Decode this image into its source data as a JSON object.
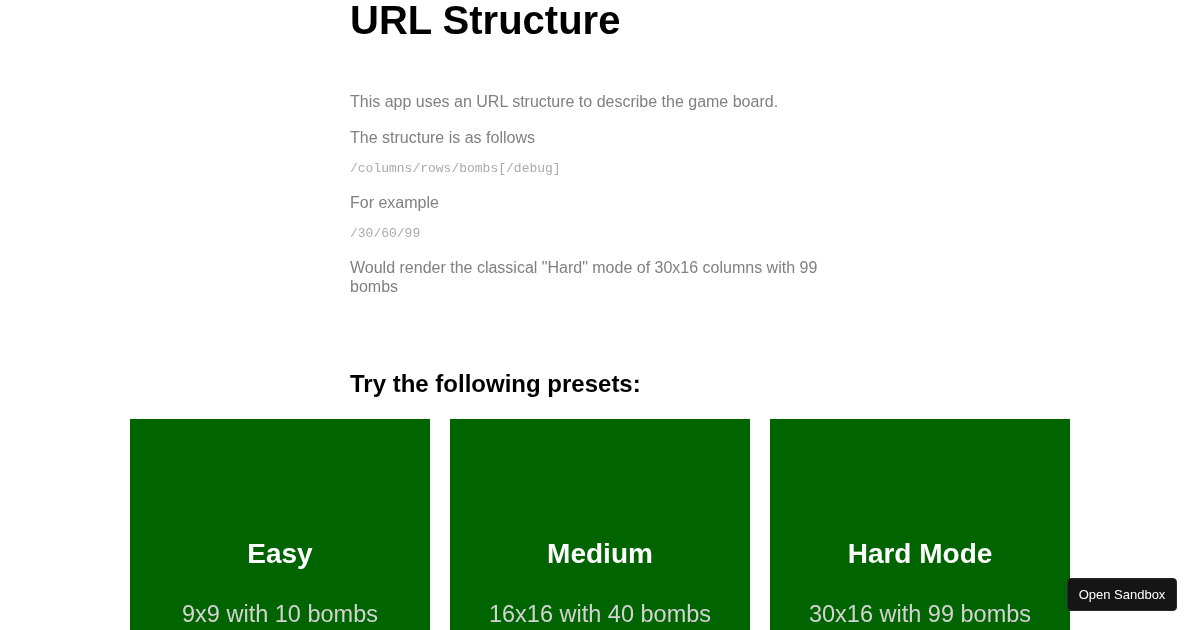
{
  "title": "URL Structure",
  "intro": [
    {
      "kind": "text",
      "text": "This app uses an URL structure to describe the game board."
    },
    {
      "kind": "text",
      "text": "The structure is as follows"
    },
    {
      "kind": "code",
      "text": "/columns/rows/bombs[/debug]"
    },
    {
      "kind": "text",
      "text": "For example"
    },
    {
      "kind": "code",
      "text": "/30/60/99"
    },
    {
      "kind": "text",
      "text": "Would render the classical \"Hard\" mode of 30x16 columns with 99 bombs"
    }
  ],
  "presets_heading": "Try the following presets:",
  "presets": [
    {
      "name": "Easy",
      "description": "9x9 with 10 bombs"
    },
    {
      "name": "Medium",
      "description": "16x16 with 40 bombs"
    },
    {
      "name": "Hard Mode",
      "description": "30x16 with 99 bombs"
    }
  ],
  "sandbox_button": "Open Sandbox"
}
